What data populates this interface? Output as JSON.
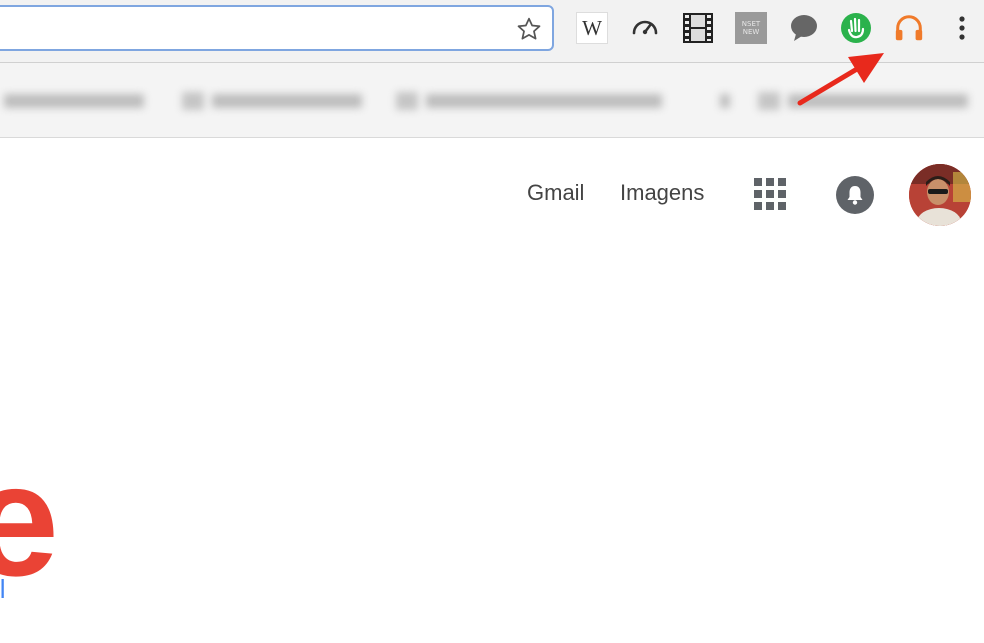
{
  "browser": {
    "address_value": "",
    "extensions": [
      {
        "name": "wikipedia-extension-icon",
        "glyph": "W"
      },
      {
        "name": "speed-test-icon"
      },
      {
        "name": "film-strip-icon"
      },
      {
        "name": "new-badge-icon",
        "label_line1": "NSET",
        "label_line2": "NEW"
      },
      {
        "name": "chat-bubble-icon"
      },
      {
        "name": "green-hand-extension-icon",
        "color": "#2bb24c"
      },
      {
        "name": "headphones-extension-icon",
        "color": "#f07a2a"
      },
      {
        "name": "more-menu-icon"
      }
    ],
    "highlight_arrow_color": "#e8291c"
  },
  "bookmarks": {
    "items": [
      {
        "label": "LASER DOM..."
      },
      {
        "label": "Private Folder"
      },
      {
        "label": "HOTBED TECHTURE"
      },
      {
        "label": "Outros favoritos"
      }
    ]
  },
  "google_header": {
    "gmail_label": "Gmail",
    "images_label": "Imagens"
  },
  "logo": {
    "visible_letter": "e",
    "subtext": "il",
    "letter_color": "#ea4335",
    "subtext_color": "#4285f4"
  }
}
